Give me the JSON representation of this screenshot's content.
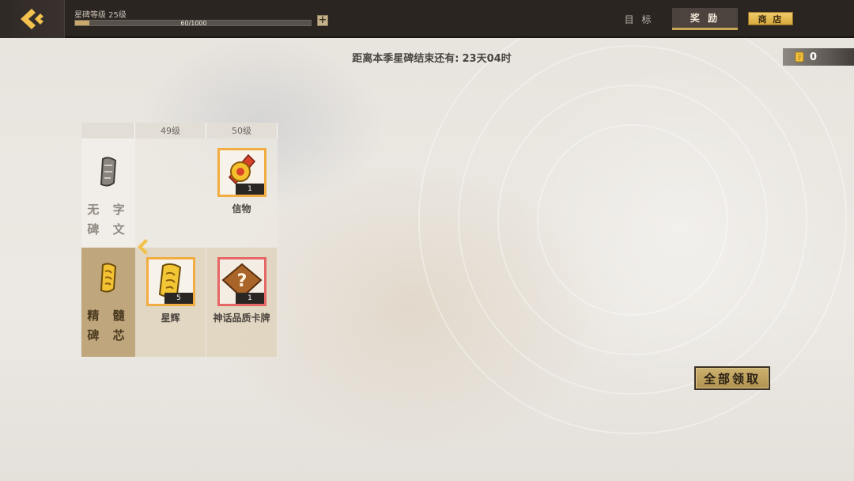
{
  "header": {
    "level_label": "星碑等级 25级",
    "progress_text": "60/1000",
    "progress_fraction": 0.06,
    "tabs": [
      {
        "label": "目 标",
        "active": false
      },
      {
        "label": "奖 励",
        "active": true
      },
      {
        "label": "商 店",
        "active": false
      }
    ]
  },
  "countdown": {
    "label": "距离本季星碑结束还有:",
    "value": "23天04时"
  },
  "currency": {
    "icon": "scroll-currency-icon",
    "value": "0"
  },
  "grid": {
    "columns": [
      "",
      "49级",
      "50级"
    ],
    "rows": [
      {
        "label": "无字碑文",
        "label_lines": [
          "无 字",
          "碑 文"
        ],
        "icon": "stone-tablet-icon",
        "cells": [
          null,
          {
            "name": "信物",
            "qty": "1",
            "icon": "golden-token-icon",
            "frame": "gold"
          }
        ]
      },
      {
        "label": "精髓碑芯",
        "label_lines": [
          "精 髓",
          "碑 芯"
        ],
        "icon": "golden-scroll-icon",
        "cells": [
          {
            "name": "星辉",
            "qty": "5",
            "icon": "golden-scroll-icon",
            "frame": "gold"
          },
          {
            "name": "神话品质卡牌",
            "qty": "1",
            "icon": "mystery-card-icon",
            "frame": "red"
          }
        ]
      }
    ]
  },
  "claim_all_label": "全部领取",
  "colors": {
    "topbar": "#2b2522",
    "accent_gold": "#c9a653",
    "frame_gold": "#f1ad41",
    "frame_red": "#e56766"
  }
}
